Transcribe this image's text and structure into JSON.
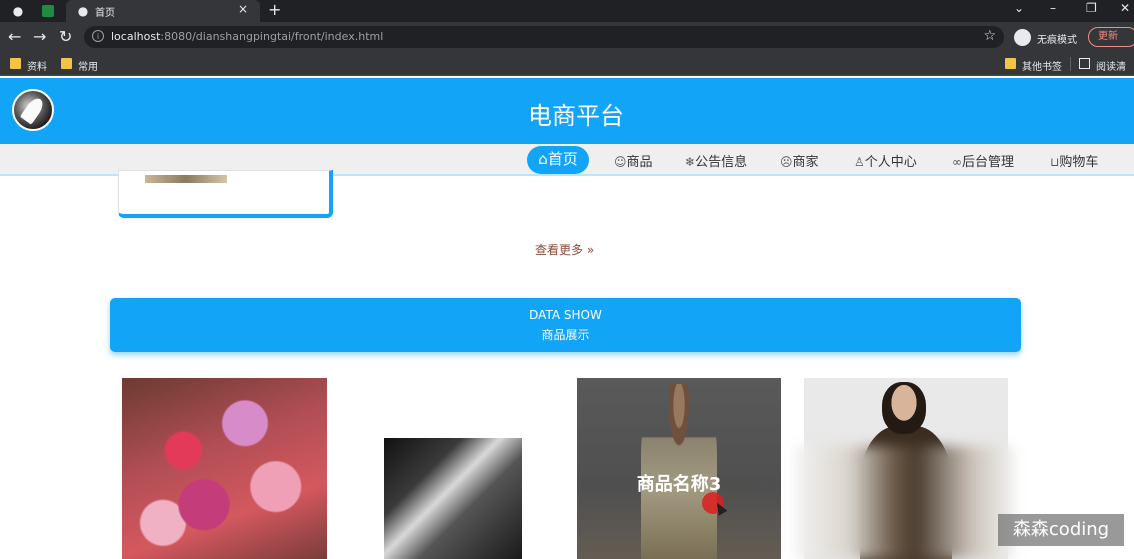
{
  "browser": {
    "tab_title": "首页",
    "url_host": "localhost",
    "url_rest": ":8080/dianshangpingtai/front/index.html",
    "incognito_label": "无痕模式",
    "update_label": "更新",
    "bookmarks": [
      "资料",
      "常用"
    ],
    "other_bookmarks": "其他书签",
    "reading_list": "阅读清单"
  },
  "site": {
    "title": "电商平台",
    "nav": [
      {
        "label": "首页",
        "icon": "home-icon"
      },
      {
        "label": "商品",
        "icon": "product-icon"
      },
      {
        "label": "公告信息",
        "icon": "snowflake-icon"
      },
      {
        "label": "商家",
        "icon": "shop-icon"
      },
      {
        "label": "个人中心",
        "icon": "user-icon"
      },
      {
        "label": "后台管理",
        "icon": "link-icon"
      },
      {
        "label": "购物车",
        "icon": "cart-icon"
      }
    ],
    "more_link": "查看更多 »",
    "banner": {
      "en": "DATA SHOW",
      "cn": "商品展示"
    },
    "products": [
      {
        "title": "商品名称3"
      }
    ],
    "watermark": "森森coding"
  },
  "colors": {
    "accent": "#12a4f6",
    "chrome_dark": "#202124",
    "chrome_mid": "#35363a"
  }
}
